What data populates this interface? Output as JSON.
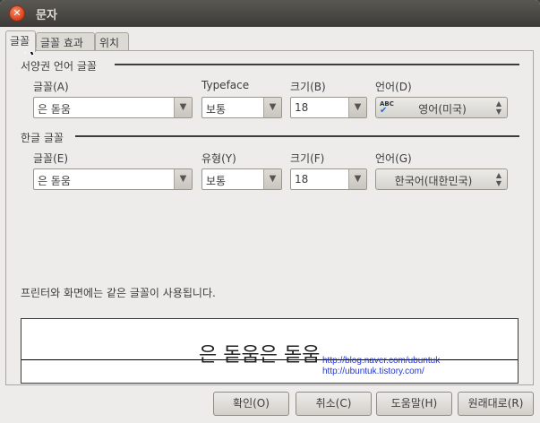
{
  "window": {
    "title": "문자",
    "close_glyph": "✕"
  },
  "tabs": [
    {
      "label": "글꼴",
      "active": true
    },
    {
      "label": "글꼴 효과",
      "active": false
    },
    {
      "label": "위치",
      "active": false
    }
  ],
  "western": {
    "section_title": "서양권 언어 글꼴",
    "font_label": "글꼴(A)",
    "font_value": "은 돋움",
    "typeface_label": "Typeface",
    "typeface_value": "보통",
    "size_label": "크기(B)",
    "size_value": "18",
    "language_label": "언어(D)",
    "language_value": "영어(미국)",
    "language_icon": "spellcheck-abc-icon"
  },
  "asian": {
    "section_title": "한글 글꼴",
    "font_label": "글꼴(E)",
    "font_value": "은 돋움",
    "typeface_label": "유형(Y)",
    "typeface_value": "보통",
    "size_label": "크기(F)",
    "size_value": "18",
    "language_label": "언어(G)",
    "language_value": "한국어(대한민국)"
  },
  "info_text": "프린터와 화면에는 같은 글꼴이 사용됩니다.",
  "preview": {
    "sample_text": "은 돋움은 돋움",
    "watermark_line1": "http://blog.naver.com/ubuntuk",
    "watermark_line2": "http://ubuntuk.tistory.com/"
  },
  "buttons": {
    "ok": "확인(O)",
    "cancel": "취소(C)",
    "help": "도움말(H)",
    "reset": "원래대로(R)"
  },
  "colors": {
    "title_bar": "#3c3b37",
    "close_button": "#d8421b",
    "window_bg": "#edeceb",
    "watermark": "#2437c8"
  }
}
